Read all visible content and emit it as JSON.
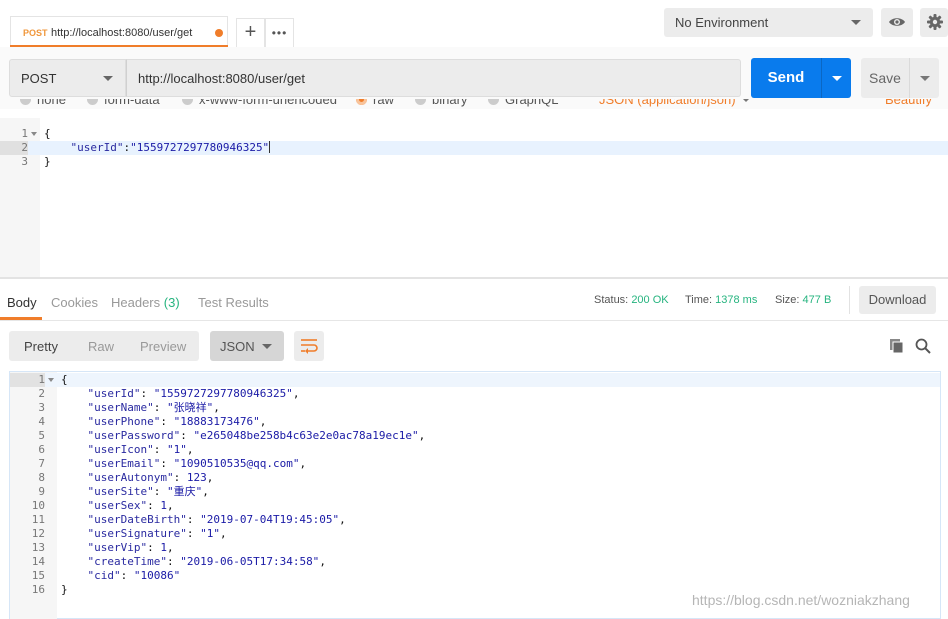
{
  "tab": {
    "method": "POST",
    "url": "http://localhost:8080/user/get",
    "add_label": "+",
    "more_label": "•••"
  },
  "environment": {
    "selected": "No Environment"
  },
  "request": {
    "method": "POST",
    "url": "http://localhost:8080/user/get",
    "send_label": "Send",
    "save_label": "Save",
    "body_types": [
      "none",
      "form-data",
      "x-www-form-urlencoded",
      "raw",
      "binary",
      "GraphQL"
    ],
    "body_type_selected": "raw",
    "content_type": "JSON (application/json)",
    "beautify_label": "Beautify",
    "body_lines": [
      {
        "n": "1",
        "text": "{"
      },
      {
        "n": "2",
        "key": "\"userId\"",
        "sep": ":",
        "value": "\"1559727297780946325\""
      },
      {
        "n": "3",
        "text": "}"
      }
    ]
  },
  "response": {
    "tabs": [
      {
        "label": "Body"
      },
      {
        "label": "Cookies"
      },
      {
        "label": "Headers",
        "count": "(3)"
      },
      {
        "label": "Test Results"
      }
    ],
    "status_label": "Status:",
    "status_value": "200 OK",
    "time_label": "Time:",
    "time_value": "1378 ms",
    "size_label": "Size:",
    "size_value": "477 B",
    "download_label": "Download",
    "views": [
      "Pretty",
      "Raw",
      "Preview"
    ],
    "view_selected": "Pretty",
    "format": "JSON",
    "lines": [
      {
        "n": "1",
        "text": "{"
      },
      {
        "n": "2",
        "key": "\"userId\"",
        "value": "\"1559727297780946325\"",
        "trail": ","
      },
      {
        "n": "3",
        "key": "\"userName\"",
        "value": "\"张晓祥\"",
        "trail": ","
      },
      {
        "n": "4",
        "key": "\"userPhone\"",
        "value": "\"18883173476\"",
        "trail": ","
      },
      {
        "n": "5",
        "key": "\"userPassword\"",
        "value": "\"e265048be258b4c63e2e0ac78a19ec1e\"",
        "trail": ","
      },
      {
        "n": "6",
        "key": "\"userIcon\"",
        "value": "\"1\"",
        "trail": ","
      },
      {
        "n": "7",
        "key": "\"userEmail\"",
        "value": "\"1090510535@qq.com\"",
        "trail": ","
      },
      {
        "n": "8",
        "key": "\"userAutonym\"",
        "value": "123",
        "trail": ","
      },
      {
        "n": "9",
        "key": "\"userSite\"",
        "value": "\"重庆\"",
        "trail": ","
      },
      {
        "n": "10",
        "key": "\"userSex\"",
        "value": "1",
        "trail": ","
      },
      {
        "n": "11",
        "key": "\"userDateBirth\"",
        "value": "\"2019-07-04T19:45:05\"",
        "trail": ","
      },
      {
        "n": "12",
        "key": "\"userSignature\"",
        "value": "\"1\"",
        "trail": ","
      },
      {
        "n": "13",
        "key": "\"userVip\"",
        "value": "1",
        "trail": ","
      },
      {
        "n": "14",
        "key": "\"createTime\"",
        "value": "\"2019-06-05T17:34:58\"",
        "trail": ","
      },
      {
        "n": "15",
        "key": "\"cid\"",
        "value": "\"10086\"",
        "trail": ""
      },
      {
        "n": "16",
        "text": "}"
      }
    ]
  },
  "watermark": "https://blog.csdn.net/wozniakzhang",
  "icons": {
    "eye": "eye-icon",
    "gear": "gear-icon",
    "wrap": "wrap-lines-icon",
    "copy": "copy-icon",
    "search": "search-icon"
  },
  "colors": {
    "accent": "#f07d2a",
    "send": "#097bed",
    "success": "#26b47f",
    "method_post": "#f0963a"
  }
}
